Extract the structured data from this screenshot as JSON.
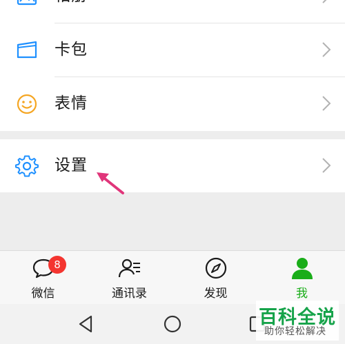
{
  "menu": {
    "album": {
      "label": "相册",
      "icon": "album-icon"
    },
    "cards": {
      "label": "卡包",
      "icon": "card-wallet-icon"
    },
    "stickers": {
      "label": "表情",
      "icon": "smiley-icon"
    },
    "settings": {
      "label": "设置",
      "icon": "gear-icon"
    }
  },
  "tabbar": {
    "chats": {
      "label": "微信",
      "icon": "chat-bubble-icon",
      "badge": "8"
    },
    "contacts": {
      "label": "通讯录",
      "icon": "contacts-icon"
    },
    "discover": {
      "label": "发现",
      "icon": "compass-icon"
    },
    "me": {
      "label": "我",
      "icon": "person-icon",
      "active": true
    }
  },
  "system_nav": {
    "back": "back-triangle-icon",
    "home": "home-circle-icon",
    "recents": "recents-square-icon"
  },
  "watermark": {
    "title": "百科全说",
    "subtitle": "助你轻松解决"
  },
  "colors": {
    "accent_green": "#1aad19",
    "blue_icon": "#1e90ff",
    "orange_icon": "#f5a623",
    "badge_red": "#f43530",
    "arrow_pink": "#e0357a"
  }
}
